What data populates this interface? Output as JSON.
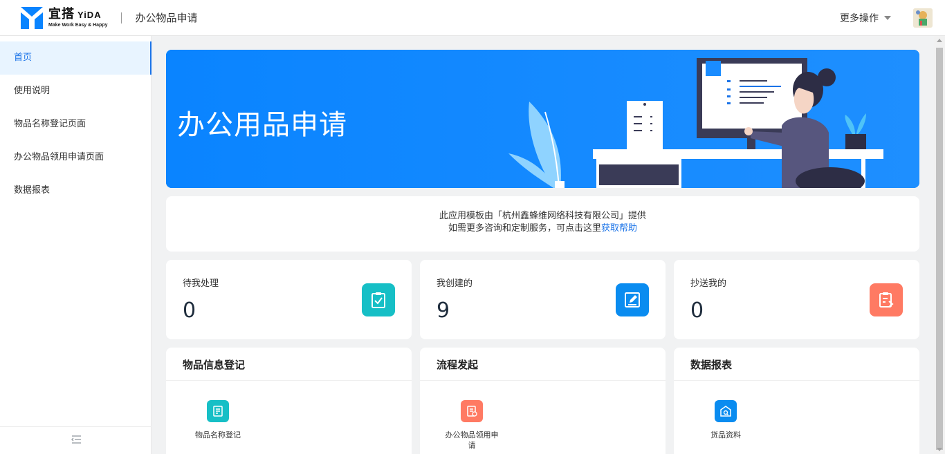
{
  "header": {
    "logo_cn": "宜搭",
    "logo_en": "YiDA",
    "slogan": "Make Work Easy & Happy",
    "app_title": "办公物品申请",
    "more_actions": "更多操作"
  },
  "sidebar": {
    "items": [
      {
        "label": "首页",
        "active": true
      },
      {
        "label": "使用说明",
        "active": false
      },
      {
        "label": "物品名称登记页面",
        "active": false
      },
      {
        "label": "办公物品领用申请页面",
        "active": false
      },
      {
        "label": "数据报表",
        "active": false
      }
    ]
  },
  "banner": {
    "title": "办公用品申请"
  },
  "notice": {
    "line1": "此应用模板由「杭州鑫蜂维网络科技有限公司」提供",
    "line2_prefix": "如需更多咨询和定制服务，可点击这里",
    "line2_link": "获取帮助"
  },
  "stats": [
    {
      "label": "待我处理",
      "value": "0",
      "color": "#16bfc6",
      "icon": "clipboard-check-icon"
    },
    {
      "label": "我创建的",
      "value": "9",
      "color": "#0a8cf0",
      "icon": "edit-document-icon"
    },
    {
      "label": "抄送我的",
      "value": "0",
      "color": "#ff7a63",
      "icon": "cc-document-icon"
    }
  ],
  "sections": [
    {
      "title": "物品信息登记",
      "entry_label": "物品名称登记",
      "color": "#16bfc6",
      "icon": "register-form-icon"
    },
    {
      "title": "流程发起",
      "entry_label": "办公物品领用申请",
      "color": "#ff7a63",
      "icon": "apply-form-icon"
    },
    {
      "title": "数据报表",
      "entry_label": "货品资料",
      "color": "#0a8cf0",
      "icon": "warehouse-icon"
    }
  ]
}
